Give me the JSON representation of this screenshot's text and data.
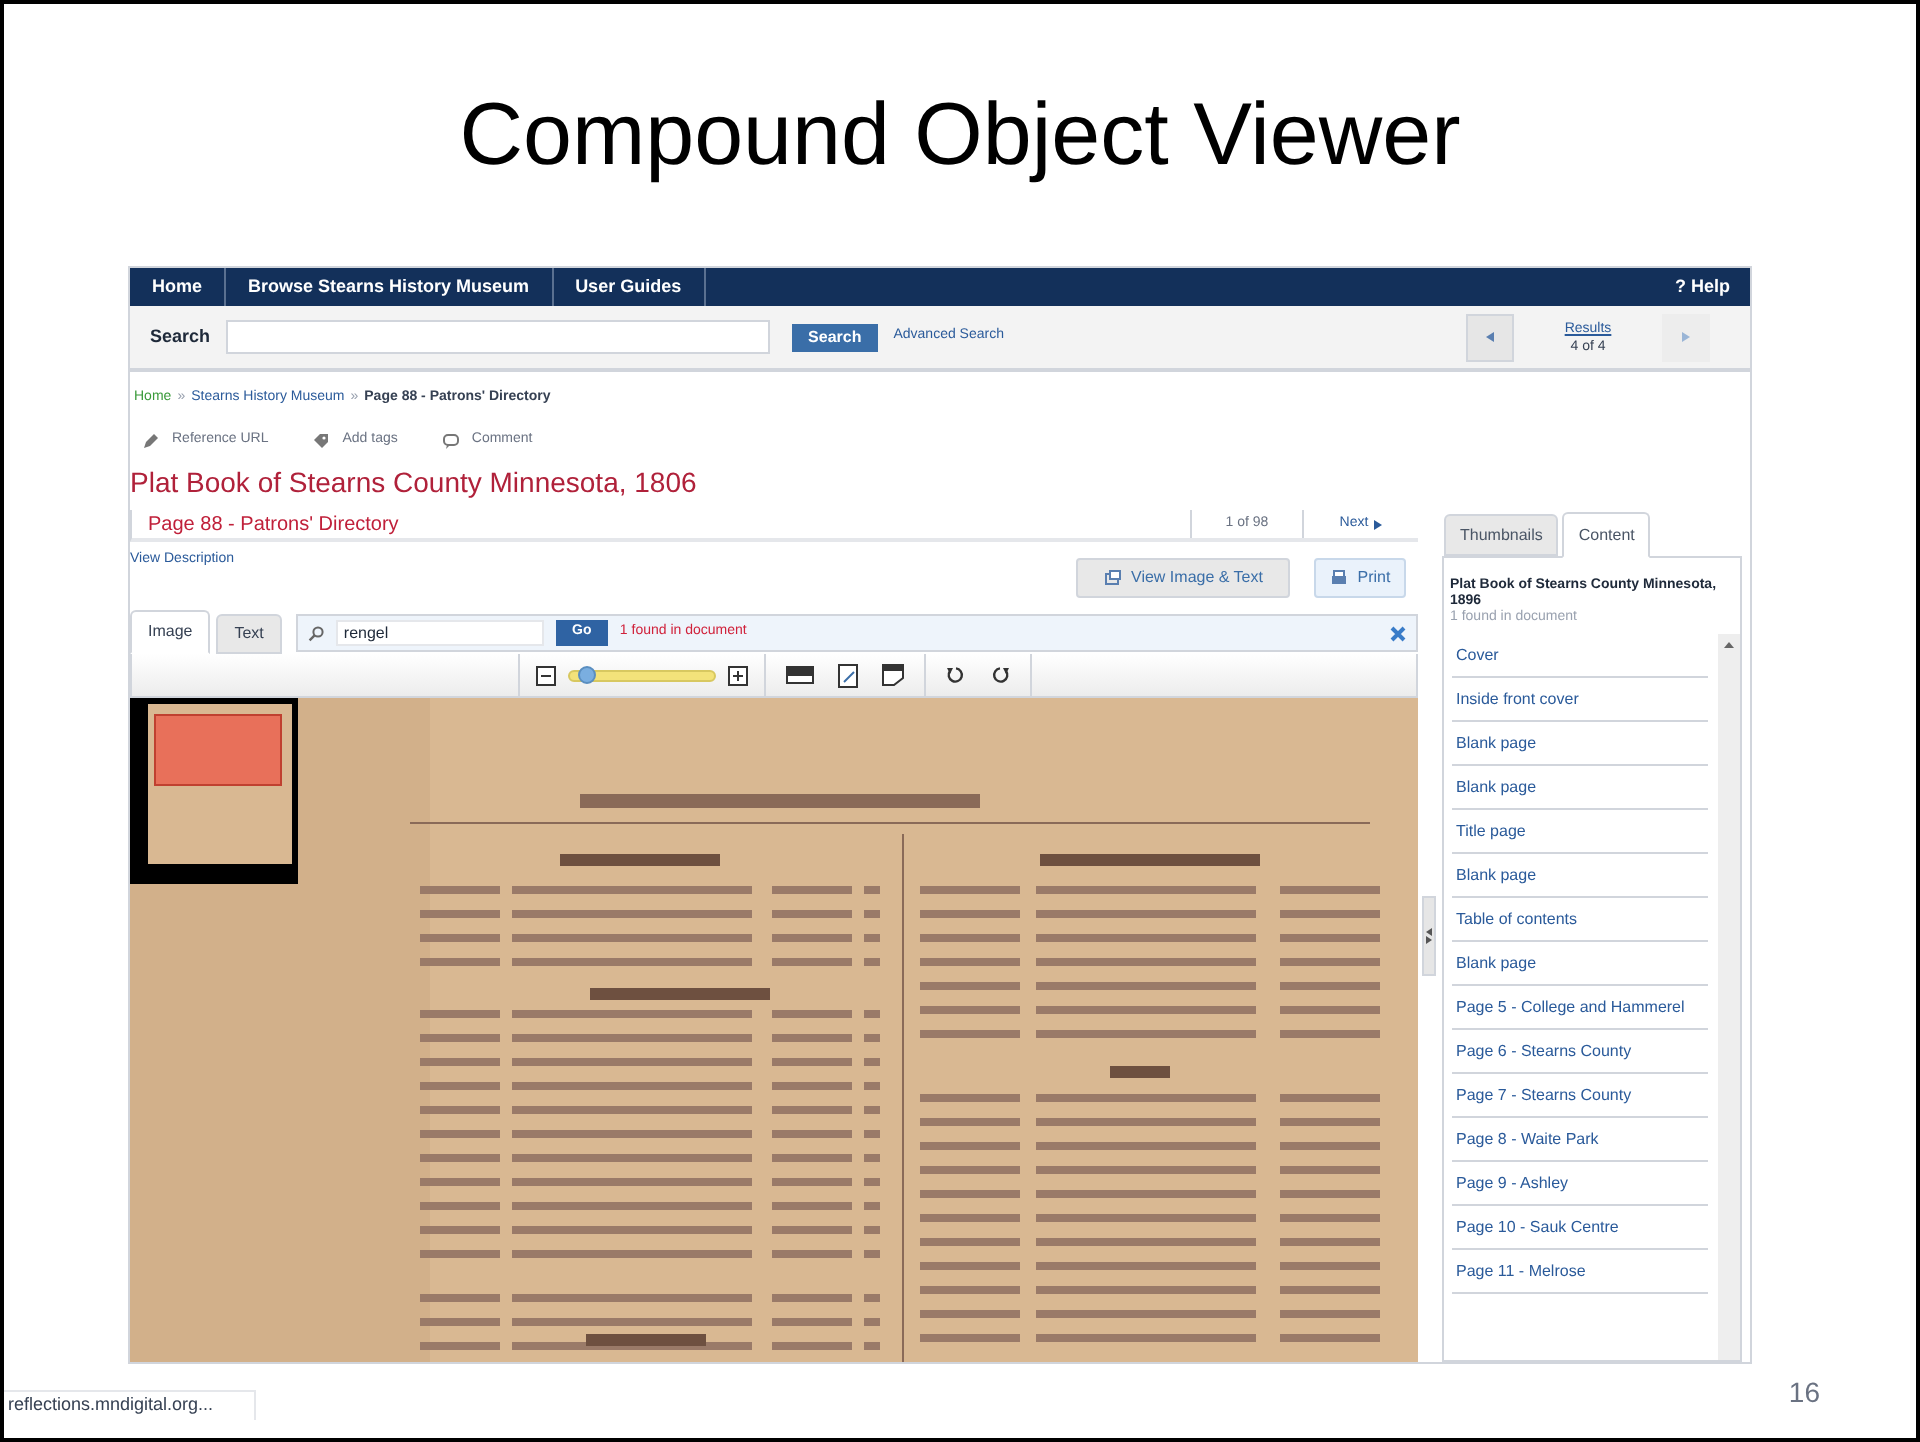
{
  "slide": {
    "title": "Compound Object Viewer",
    "page_number": "16",
    "status_text": "reflections.mndigital.org..."
  },
  "nav": {
    "items": [
      {
        "label": "Home"
      },
      {
        "label": "Browse Stearns History Museum"
      },
      {
        "label": "User Guides"
      }
    ],
    "help": "? Help"
  },
  "search": {
    "label": "Search",
    "button": "Search",
    "advanced": "Advanced Search",
    "results_label": "Results",
    "results_count": "4 of 4"
  },
  "breadcrumb": {
    "items": [
      "Home",
      "Stearns History Museum",
      "Page 88 - Patrons' Directory"
    ],
    "separator": "»"
  },
  "actions": [
    "Reference URL",
    "Add tags",
    "Comment"
  ],
  "title": "Plat Book of Stearns County Minnesota, 1806",
  "item": {
    "subtitle": "Page 88 - Patrons' Directory",
    "page_count": "1 of 98",
    "next": "Next"
  },
  "view_description": "View Description",
  "buttons": [
    "View Image & Text",
    "Print"
  ],
  "viewer_tabs": [
    {
      "label": "Image",
      "selected": true
    },
    {
      "label": "Text",
      "selected": false
    }
  ],
  "doc_search": {
    "value": "rengel",
    "button": "Go",
    "result": "1 found in document"
  },
  "zoom": {
    "level": 0.1
  },
  "side_tabs": [
    {
      "label": "Thumbnails",
      "selected": false
    },
    {
      "label": "Content",
      "selected": true
    }
  ],
  "contents": {
    "title": "Plat Book of Stearns County Minnesota, 1896",
    "found": "1 found in document",
    "items": [
      "Cover",
      "Inside front cover",
      "Blank page",
      "Blank page",
      "Title page",
      "Blank page",
      "Table of contents",
      "Blank page",
      "Page 5 - College and Hammerel",
      "Page 6 - Stearns County",
      "Page 7 - Stearns County",
      "Page 8 - Waite Park",
      "Page 9 - Ashley",
      "Page 10 - Sauk Centre",
      "Page 11 - Melrose"
    ]
  }
}
